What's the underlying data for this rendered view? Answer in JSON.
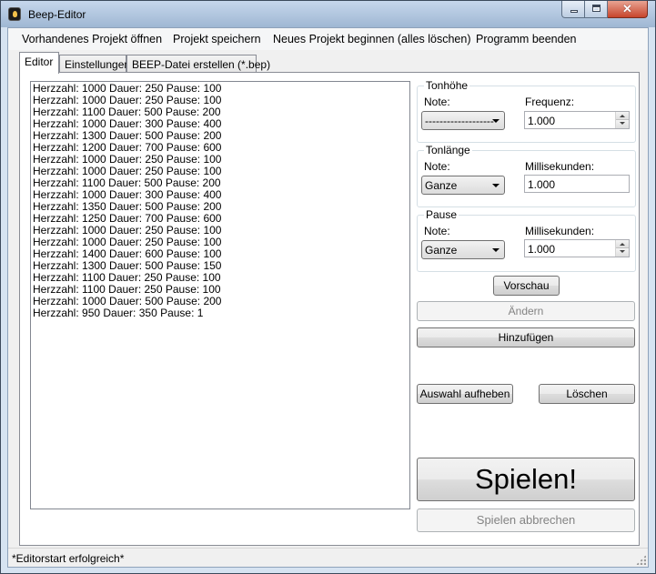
{
  "window": {
    "title": "Beep-Editor",
    "close_glyph": "✕"
  },
  "menu": [
    "Vorhandenes Projekt öffnen",
    "Projekt speichern",
    "Neues Projekt beginnen (alles löschen)",
    "Programm beenden"
  ],
  "tabs": [
    "Editor",
    "Einstellungen",
    "BEEP-Datei erstellen (*.bep)"
  ],
  "list_items": [
    "Herzzahl: 1000  Dauer: 250  Pause: 100",
    "Herzzahl: 1000  Dauer: 250  Pause: 100",
    "Herzzahl: 1100  Dauer: 500  Pause: 200",
    "Herzzahl: 1000  Dauer: 300  Pause: 400",
    "Herzzahl: 1300  Dauer: 500  Pause: 200",
    "Herzzahl: 1200  Dauer: 700  Pause: 600",
    "Herzzahl: 1000  Dauer: 250  Pause: 100",
    "Herzzahl: 1000  Dauer: 250  Pause: 100",
    "Herzzahl: 1100  Dauer: 500  Pause: 200",
    "Herzzahl: 1000  Dauer: 300  Pause: 400",
    "Herzzahl: 1350  Dauer: 500  Pause: 200",
    "Herzzahl: 1250  Dauer: 700  Pause: 600",
    "Herzzahl: 1000  Dauer: 250  Pause: 100",
    "Herzzahl: 1000  Dauer: 250  Pause: 100",
    "Herzzahl: 1400  Dauer: 600  Pause: 100",
    "Herzzahl: 1300  Dauer: 500  Pause: 150",
    "Herzzahl: 1100  Dauer: 250  Pause: 100",
    "Herzzahl: 1100  Dauer: 250  Pause: 100",
    "Herzzahl: 1000  Dauer: 500  Pause: 200",
    "Herzzahl: 950  Dauer: 350  Pause: 1"
  ],
  "tonhoehe": {
    "title": "Tonhöhe",
    "note_label": "Note:",
    "note_value": "-------------------",
    "freq_label": "Frequenz:",
    "freq_value": "1.000"
  },
  "tonlaenge": {
    "title": "Tonlänge",
    "note_label": "Note:",
    "note_value": "Ganze",
    "ms_label": "Millisekunden:",
    "ms_value": "1.000"
  },
  "pause": {
    "title": "Pause",
    "note_label": "Note:",
    "note_value": "Ganze",
    "ms_label": "Millisekunden:",
    "ms_value": "1.000"
  },
  "buttons": {
    "vorschau": "Vorschau",
    "aendern": "Ändern",
    "hinzufuegen": "Hinzufügen",
    "auswahl_aufheben": "Auswahl aufheben",
    "loeschen": "Löschen",
    "spielen": "Spielen!",
    "spielen_abbrechen": "Spielen abbrechen"
  },
  "status": "*Editorstart erfolgreich*"
}
